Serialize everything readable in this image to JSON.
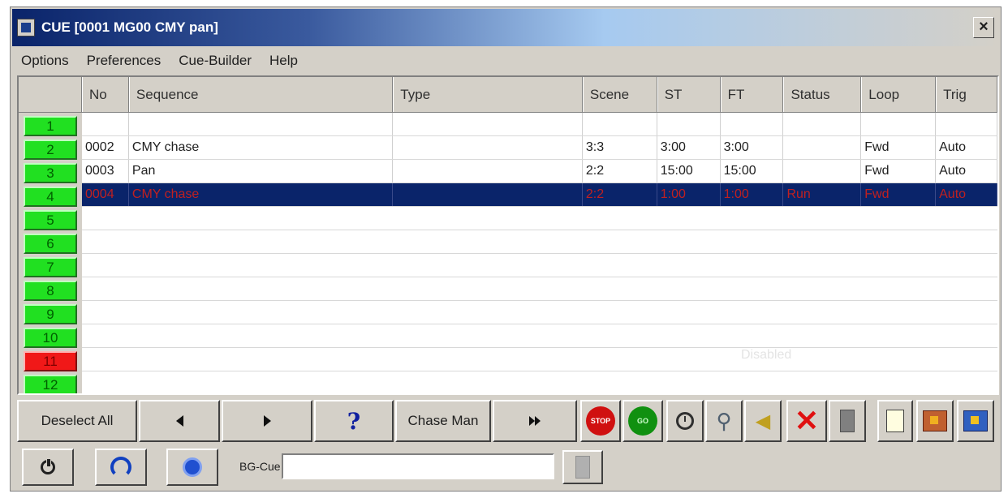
{
  "window": {
    "title": "CUE [0001 MG00 CMY pan]",
    "close_label": "×"
  },
  "menu": [
    "Options",
    "Preferences",
    "Cue-Builder",
    "Help"
  ],
  "columns": [
    "No",
    "Sequence",
    "Type",
    "Scene",
    "ST",
    "FT",
    "Status",
    "Loop",
    "Trig"
  ],
  "cue_buttons": [
    "1",
    "2",
    "3",
    "4",
    "5",
    "6",
    "7",
    "8",
    "9",
    "10",
    "11",
    "12"
  ],
  "active_cue_colors": {
    "green": "#21e021",
    "red": "#f01818",
    "selected_row": "#0a246a"
  },
  "rows": [
    {
      "no": "",
      "sequence": "",
      "type": "",
      "scene": "",
      "st": "",
      "ft": "",
      "status": "",
      "loop": "",
      "trig": ""
    },
    {
      "no": "0002",
      "sequence": "CMY chase",
      "type": "",
      "scene": "3:3",
      "st": "3:00",
      "ft": "3:00",
      "status": "",
      "loop": "Fwd",
      "trig": "Auto"
    },
    {
      "no": "0003",
      "sequence": "Pan",
      "type": "",
      "scene": "2:2",
      "st": "15:00",
      "ft": "15:00",
      "status": "",
      "loop": "Fwd",
      "trig": "Auto"
    },
    {
      "no": "0004",
      "sequence": "CMY chase",
      "type": "",
      "scene": "2:2",
      "st": "1:00",
      "ft": "1:00",
      "status": "Run",
      "loop": "Fwd",
      "trig": "Auto"
    }
  ],
  "disabled_label": "Disabled",
  "toolbar": {
    "deselect_all": "Deselect All",
    "chase_man": "Chase Man",
    "help_label": "?",
    "stop_label": "STOP",
    "go_label": "GO"
  },
  "bgcue": {
    "label": "BG-Cue",
    "value": ""
  }
}
